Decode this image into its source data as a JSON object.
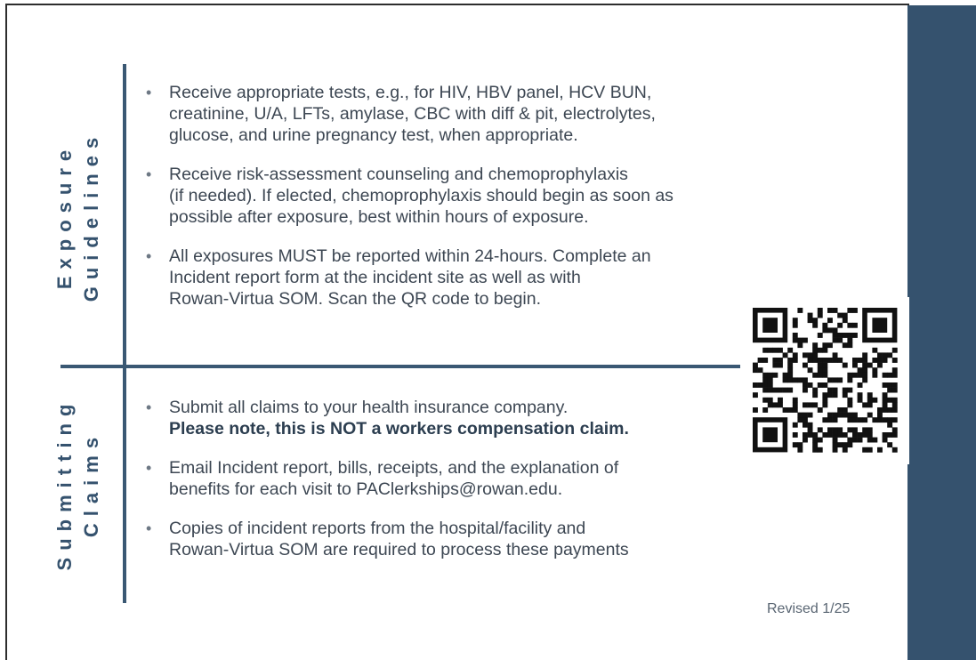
{
  "sections": {
    "exposure": {
      "title_line1": "Exposure",
      "title_line2": "Guidelines",
      "bullets": [
        "Receive appropriate tests, e.g., for HIV, HBV panel, HCV BUN,\ncreatinine, U/A, LFTs, amylase, CBC with diff & pit, electrolytes,\nglucose, and urine pregnancy test, when appropriate.",
        "Receive risk-assessment counseling and chemoprophylaxis\n(if needed). If elected, chemoprophylaxis should begin as soon as\npossible after exposure, best within hours of exposure.",
        "All exposures MUST be reported within 24-hours. Complete an\nIncident report form at the incident site as well as with\nRowan-Virtua SOM. Scan the QR code to begin."
      ]
    },
    "claims": {
      "title_line1": "Submitting",
      "title_line2": "Claims",
      "bullet1": "Submit all claims to your health insurance company.",
      "bullet1_note": "Please note, this is NOT a workers compensation claim.",
      "bullet2": "Email Incident report, bills, receipts, and the explanation of\nbenefits for each visit to PAClerkships@rowan.edu.",
      "bullet3": "Copies of incident reports from the hospital/facility and\nRowan-Virtua SOM are required to process these payments"
    }
  },
  "footer": {
    "revised": "Revised 1/25"
  },
  "bullet_glyph": "•",
  "colors": {
    "accent": "#35526e",
    "text": "#3d4753"
  }
}
